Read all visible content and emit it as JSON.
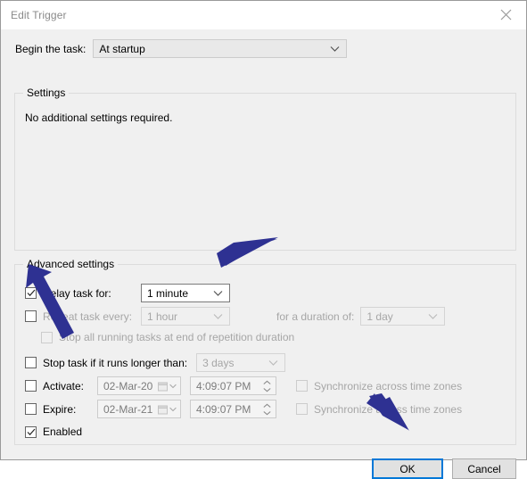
{
  "window": {
    "title": "Edit Trigger",
    "close_icon": "close-icon"
  },
  "begin": {
    "label": "Begin the task:",
    "value": "At startup",
    "arrow_icon": "chevron-down-icon"
  },
  "settings_group": {
    "title": "Settings",
    "text": "No additional settings required."
  },
  "advanced_group": {
    "title": "Advanced settings",
    "delay": {
      "label": "Delay task for:",
      "checked": "checked",
      "value": "1 minute"
    },
    "repeat": {
      "label": "Repeat task every:",
      "checked": "unchecked",
      "value": "1 hour",
      "duration_label": "for a duration of:",
      "duration_value": "1 day"
    },
    "stop_all": {
      "label": "Stop all running tasks at end of repetition duration",
      "checked": "unchecked"
    },
    "stop_task": {
      "label": "Stop task if it runs longer than:",
      "checked": "unchecked",
      "value": "3 days"
    },
    "activate": {
      "label": "Activate:",
      "checked": "unchecked",
      "date": "02-Mar-20",
      "time": "4:09:07 PM",
      "sync_label": "Synchronize across time zones",
      "sync_checked": "unchecked"
    },
    "expire": {
      "label": "Expire:",
      "checked": "unchecked",
      "date": "02-Mar-21",
      "time": "4:09:07 PM",
      "sync_label": "Synchronize across time zones",
      "sync_checked": "unchecked"
    },
    "enabled": {
      "label": "Enabled",
      "checked": "checked"
    }
  },
  "footer": {
    "ok_label": "OK",
    "cancel_label": "Cancel"
  },
  "annotations": {
    "arrow_color": "#2e3192",
    "arrow_to_delay_dropdown": "arrow-icon",
    "arrow_to_delay_checkbox": "arrow-icon",
    "arrow_to_ok_button": "arrow-icon"
  },
  "colors": {
    "accent": "#0078d7",
    "dialog_background": "#f0f0f0",
    "title_text": "#8a8a8a",
    "disabled_text": "#a6a6a6"
  }
}
